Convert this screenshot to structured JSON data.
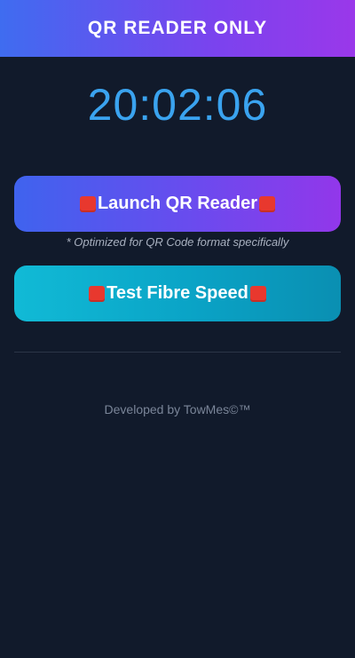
{
  "header": {
    "title": "QR READER ONLY"
  },
  "clock": {
    "time": "20:02:06"
  },
  "buttons": {
    "qr_reader": {
      "label": "Launch QR Reader"
    },
    "fibre_speed": {
      "label": "Test Fibre Speed"
    }
  },
  "note": {
    "text": "* Optimized for QR Code format specifically"
  },
  "footer": {
    "text": "Developed by TowMes©™"
  },
  "colors": {
    "background": "#111a2b",
    "clock": "#3aa3ef",
    "accent_purple": "#7a43ee",
    "accent_teal": "#0aa3c6",
    "emoji_square": "#e8382e"
  },
  "icons": [
    "red-square-icon"
  ]
}
